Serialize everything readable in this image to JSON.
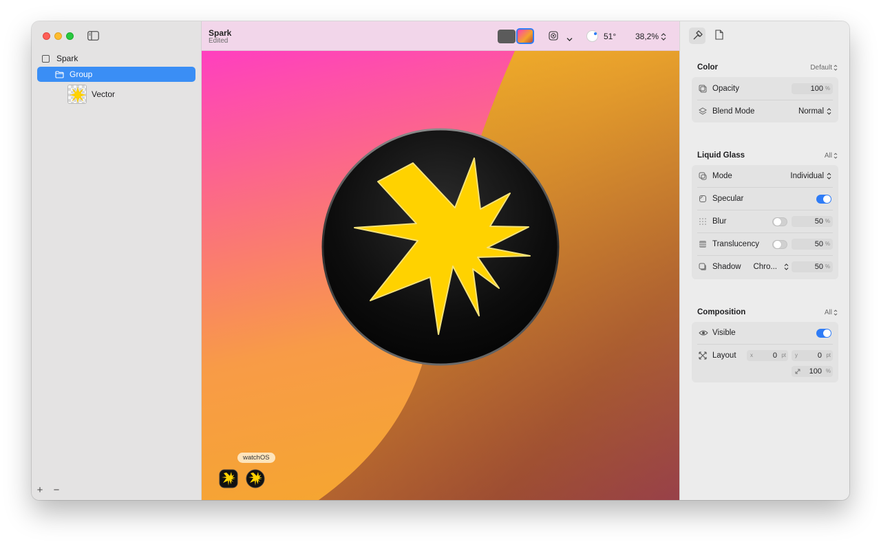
{
  "sidebar": {
    "items": [
      {
        "label": "Spark",
        "icon": "square-icon"
      },
      {
        "label": "Group",
        "icon": "folder-icon",
        "selected": true
      },
      {
        "label": "Vector",
        "icon": "vector-thumbnail"
      }
    ],
    "add_label": "+",
    "remove_label": "−"
  },
  "toolbar": {
    "title": "Spark",
    "subtitle": "Edited",
    "angle": "51°",
    "zoom": "38,2%"
  },
  "canvas": {
    "platform_label": "watchOS",
    "colors": {
      "star": "#ffd200",
      "disc": "#111111"
    }
  },
  "inspector": {
    "color": {
      "title": "Color",
      "preset": "Default",
      "opacity_label": "Opacity",
      "opacity_value": "100",
      "opacity_unit": "%",
      "blend_label": "Blend Mode",
      "blend_value": "Normal"
    },
    "liquid_glass": {
      "title": "Liquid Glass",
      "scope": "All",
      "mode_label": "Mode",
      "mode_value": "Individual",
      "specular_label": "Specular",
      "specular_on": true,
      "blur_label": "Blur",
      "blur_value": "50",
      "blur_unit": "%",
      "translucency_label": "Translucency",
      "translucency_value": "50",
      "translucency_unit": "%",
      "shadow_label": "Shadow",
      "shadow_type": "Chro...",
      "shadow_value": "50",
      "shadow_unit": "%"
    },
    "composition": {
      "title": "Composition",
      "scope": "All",
      "visible_label": "Visible",
      "visible_on": true,
      "layout_label": "Layout",
      "x_axis": "x",
      "x_value": "0",
      "x_unit": "pt",
      "y_axis": "y",
      "y_value": "0",
      "y_unit": "pt",
      "scale_value": "100",
      "scale_unit": "%"
    }
  }
}
